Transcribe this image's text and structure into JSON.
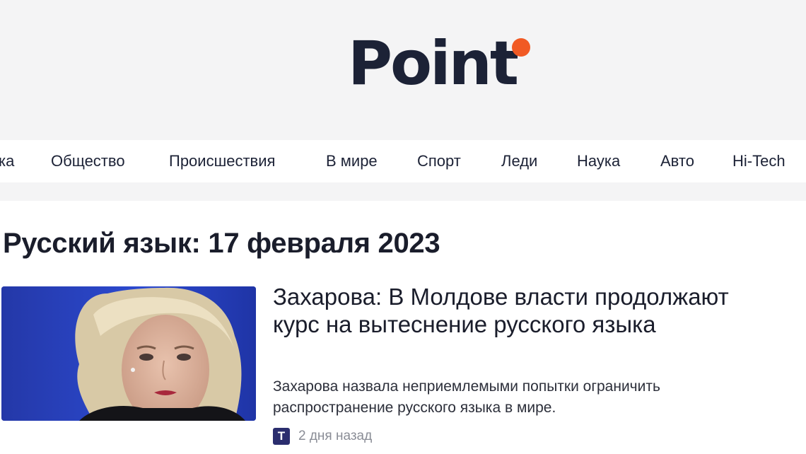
{
  "logo": {
    "text": "Point",
    "dot_color": "#f15a24"
  },
  "nav": {
    "items": [
      {
        "label": "ка"
      },
      {
        "label": "Общество"
      },
      {
        "label": "Происшествия"
      },
      {
        "label": "В мире"
      },
      {
        "label": "Спорт"
      },
      {
        "label": "Леди"
      },
      {
        "label": "Наука"
      },
      {
        "label": "Авто"
      },
      {
        "label": "Hi-Tech"
      }
    ]
  },
  "page": {
    "title": "Русский язык: 17 февраля 2023"
  },
  "article": {
    "title": "Захарова: В Молдове власти продолжают курс на вытеснение русского языка",
    "lead": "Захарова назвала неприемлемыми попытки ограничить распространение русского языка в мире.",
    "source_icon": "T",
    "time": "2 дня назад"
  }
}
